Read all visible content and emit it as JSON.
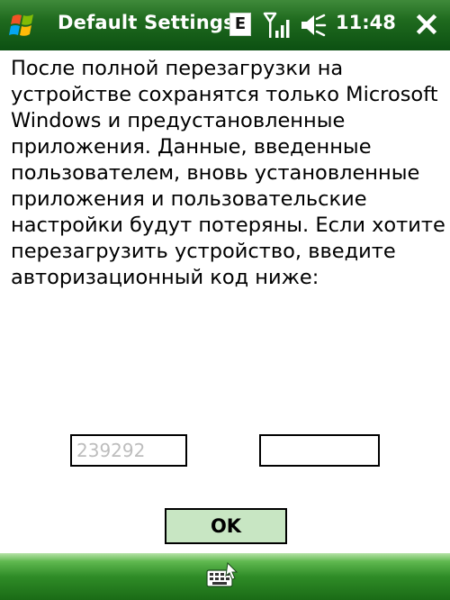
{
  "titlebar": {
    "title": "Default Settings",
    "ime_indicator": "E",
    "clock": "11:48",
    "icons": {
      "start": "windows-flag-icon",
      "signal": "signal-strength-icon",
      "volume": "volume-icon",
      "close": "close-icon"
    }
  },
  "content": {
    "message_lines": [
      "После полной перезагрузки на",
      "устройстве сохранятся только Microsoft",
      "Windows и предустановленные",
      "приложения. Данные, введенные",
      "пользователем, вновь установленные",
      "приложения и пользовательские",
      "настройки будут потеряны. Если хотите",
      "перезагрузить устройство, введите",
      "авторизационный код ниже:"
    ],
    "code_display_value": "239292",
    "code_input_value": "",
    "ok_label": "OK"
  },
  "menubar": {
    "icons": {
      "sip": "keyboard-input-icon"
    }
  },
  "colors": {
    "titlebar_bg": "#1f6a1e",
    "menubar_bg": "#2f8c27",
    "ok_button_bg": "#c8e6c3",
    "code_display_text": "#bdbdbd"
  }
}
